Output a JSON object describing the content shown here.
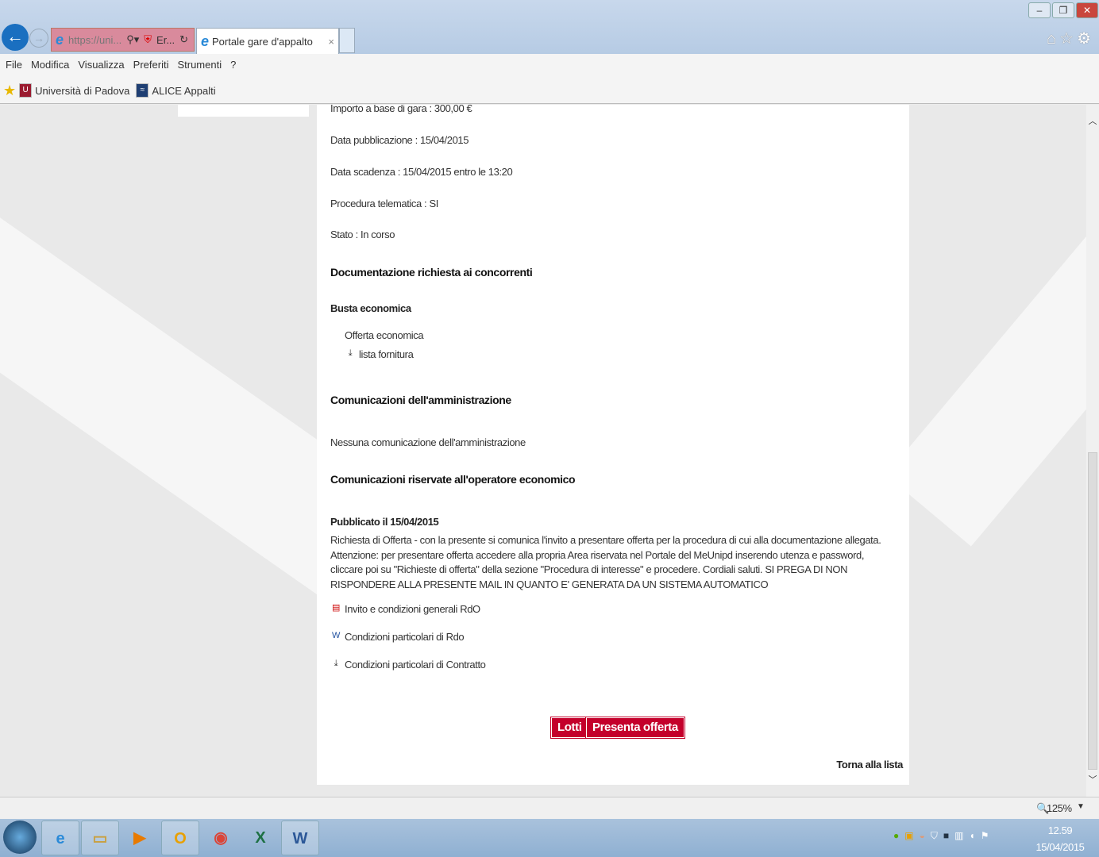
{
  "browser": {
    "address": "https://uni...",
    "security_label": "Er...",
    "tab_title": "Portale gare d'appalto",
    "tab_close": "×",
    "menu": [
      "File",
      "Modifica",
      "Visualizza",
      "Preferiti",
      "Strumenti",
      "?"
    ],
    "favorites": [
      {
        "label": "Università di Padova",
        "icon": "shield-icon",
        "color": "#9b1b30"
      },
      {
        "label": "ALICE Appalti",
        "icon": "alice-icon",
        "color": "#1f3f73"
      }
    ],
    "zoom": "125%"
  },
  "details": {
    "importo": "Importo a base di gara : 300,00 €",
    "pubblicazione": "Data pubblicazione : 15/04/2015",
    "scadenza": "Data scadenza : 15/04/2015 entro le 13:20",
    "telematica": "Procedura telematica : SI",
    "stato": "Stato : In corso"
  },
  "documentazione": {
    "title": "Documentazione richiesta ai concorrenti",
    "busta": "Busta economica",
    "offerta": "Offerta economica",
    "lista": "lista fornitura"
  },
  "comunicazioni_amm": {
    "title": "Comunicazioni dell'amministrazione",
    "empty": "Nessuna comunicazione dell'amministrazione"
  },
  "comunicazioni_op": {
    "title": "Comunicazioni riservate all'operatore economico",
    "published": "Pubblicato il 15/04/2015",
    "message": "Richiesta di Offerta - con la presente si comunica l'invito a presentare offerta per la procedura di cui alla documentazione allegata. Attenzione: per presentare offerta accedere alla propria Area riservata nel Portale del MeUnipd inserendo utenza e password, cliccare poi su \"Richieste di offerta\" della sezione \"Procedura di interesse\" e procedere. Cordiali saluti. SI PREGA DI NON RISPONDERE ALLA PRESENTE MAIL IN QUANTO E' GENERATA DA UN SISTEMA AUTOMATICO",
    "attachments": [
      {
        "label": "Invito e condizioni generali RdO",
        "icon": "pdf-icon"
      },
      {
        "label": "Condizioni particolari di Rdo",
        "icon": "word-icon"
      },
      {
        "label": "Condizioni particolari di Contratto",
        "icon": "download-icon"
      }
    ]
  },
  "actions": {
    "lotti": "Lotti",
    "presenta": "Presenta offerta",
    "torna": "Torna alla lista",
    "accent": "#c4002b"
  },
  "taskbar": {
    "time": "12.59",
    "date": "15/04/2015"
  }
}
